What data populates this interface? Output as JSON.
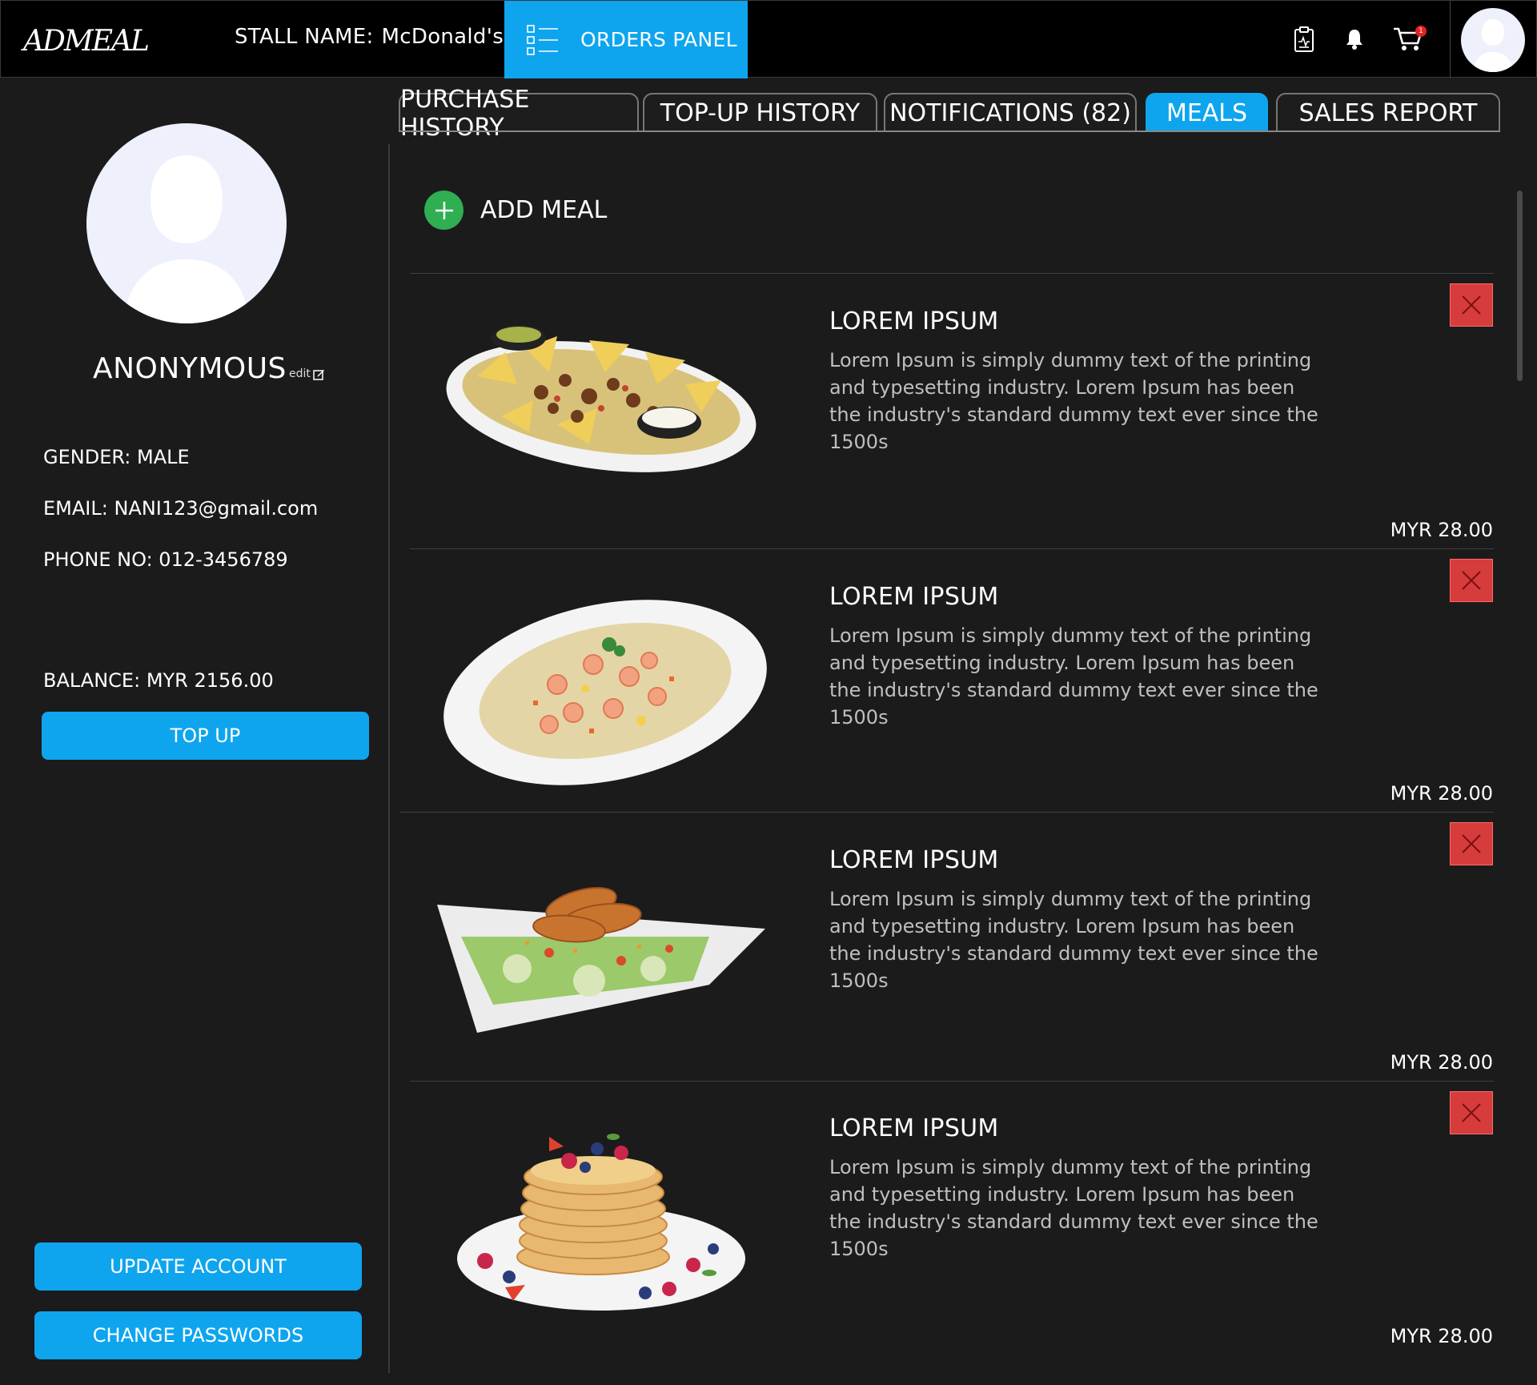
{
  "header": {
    "logo_text": "ADMEAL",
    "stall_label": "STALL NAME:",
    "stall_name": "McDonald's",
    "orders_panel_label": "ORDERS PANEL",
    "cart_badge": "1",
    "icons": [
      "list-icon",
      "clipboard-icon",
      "bell-icon",
      "cart-icon",
      "avatar-icon"
    ]
  },
  "profile": {
    "name": "ANONYMOUS",
    "edit_label": "edit",
    "gender": "GENDER: MALE",
    "email": "EMAIL: NANI123@gmail.com",
    "phone": "PHONE NO: 012-3456789",
    "balance": "BALANCE: MYR 2156.00",
    "top_up_label": "TOP UP",
    "update_account_label": "UPDATE ACCOUNT",
    "change_passwords_label": "CHANGE PASSWORDS"
  },
  "tabs": [
    {
      "label": "PURCHASE HISTORY",
      "active": false
    },
    {
      "label": "TOP-UP HISTORY",
      "active": false
    },
    {
      "label": "NOTIFICATIONS (82)",
      "active": false
    },
    {
      "label": "MEALS",
      "active": true
    },
    {
      "label": "SALES REPORT",
      "active": false
    }
  ],
  "meals": {
    "add_label": "ADD MEAL",
    "items": [
      {
        "title": "LOREM IPSUM",
        "description": "Lorem Ipsum is simply dummy text of the printing and typesetting industry. Lorem Ipsum has been the industry's standard dummy text ever since the 1500s",
        "price": "MYR 28.00",
        "image": "nachos-plate"
      },
      {
        "title": "LOREM IPSUM",
        "description": "Lorem Ipsum is simply dummy text of the printing and typesetting industry. Lorem Ipsum has been the industry's standard dummy text ever since the 1500s",
        "price": "MYR 28.00",
        "image": "shrimp-fried-rice"
      },
      {
        "title": "LOREM IPSUM",
        "description": "Lorem Ipsum is simply dummy text of the printing and typesetting industry. Lorem Ipsum has been the industry's standard dummy text ever since the 1500s",
        "price": "MYR 28.00",
        "image": "chicken-salad"
      },
      {
        "title": "LOREM IPSUM",
        "description": "Lorem Ipsum is simply dummy text of the printing and typesetting industry. Lorem Ipsum has been the industry's standard dummy text ever since the 1500s",
        "price": "MYR 28.00",
        "image": "pancake-stack"
      }
    ]
  },
  "colors": {
    "accent": "#0ea5ee",
    "background": "#1b1b1c",
    "topbar": "#000000",
    "add": "#2fae52",
    "delete": "#d63c3c"
  }
}
